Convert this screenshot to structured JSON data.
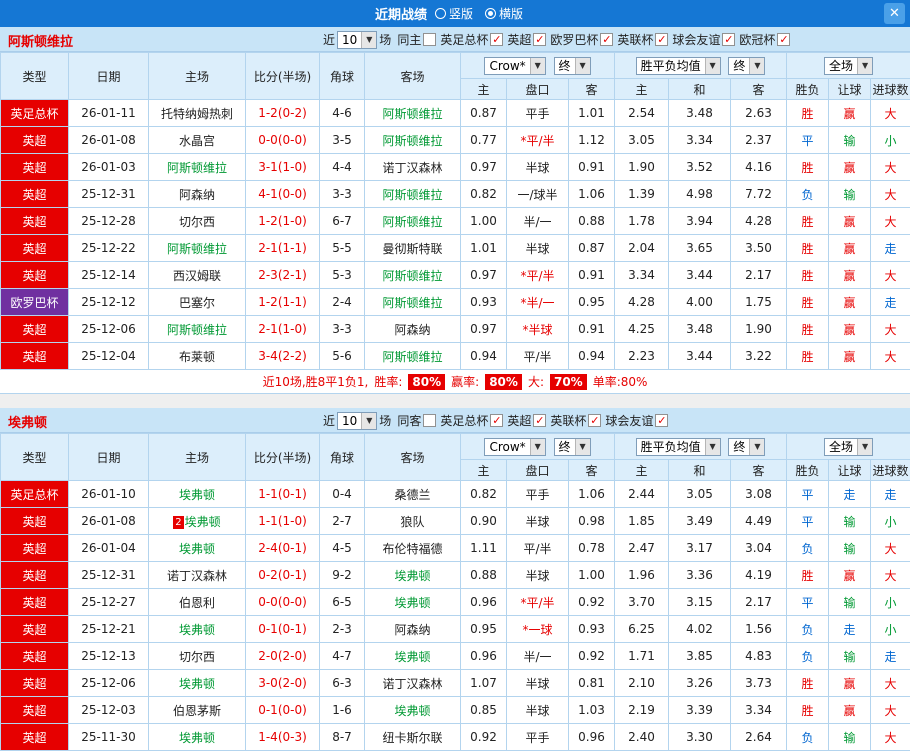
{
  "topbar": {
    "title": "近期战绩",
    "radio_vertical": "竖版",
    "radio_horizontal": "横版",
    "close_icon": "✕"
  },
  "icons": {
    "dropdown_arrow": "▼"
  },
  "controls": {
    "near": "近",
    "count": "10",
    "unit": "场"
  },
  "header_controls": {
    "company": "Crow*",
    "final": "终",
    "avg": "胜平负均值",
    "final2": "终",
    "scope": "全场"
  },
  "table_header": {
    "type": "类型",
    "date": "日期",
    "home": "主场",
    "score": "比分(半场)",
    "corner": "角球",
    "away": "客场",
    "odds_home": "主",
    "odds_line": "盘口",
    "odds_away": "客",
    "avg_home": "主",
    "avg_draw": "和",
    "avg_away": "客",
    "result": "胜负",
    "handicap": "让球",
    "goals": "进球数"
  },
  "sections": [
    {
      "team": "阿斯顿维拉",
      "filters": [
        {
          "label": "同主",
          "mark": ""
        },
        {
          "label": "英足总杯",
          "mark": "✓"
        },
        {
          "label": "英超",
          "mark": "✓"
        },
        {
          "label": "欧罗巴杯",
          "mark": "✓"
        },
        {
          "label": "英联杯",
          "mark": "✓"
        },
        {
          "label": "球会友谊",
          "mark": "✓"
        },
        {
          "label": "欧冠杯",
          "mark": "✓"
        }
      ],
      "rows": [
        {
          "type": "英足总杯",
          "type_cls": "bg-red",
          "date": "26-01-11",
          "home": "托特纳姆热刺",
          "home_cls": "",
          "score": "1-2(0-2)",
          "corner": "4-6",
          "away": "阿斯顿维拉",
          "away_cls": "c-green",
          "o1": "0.87",
          "line": "平手",
          "line_cls": "",
          "o2": "1.01",
          "a1": "2.54",
          "a2": "3.48",
          "a3": "2.63",
          "res": "胜",
          "res_cls": "c-red",
          "han": "赢",
          "han_cls": "c-red",
          "goal": "大",
          "goal_cls": "c-red"
        },
        {
          "type": "英超",
          "type_cls": "bg-red",
          "date": "26-01-08",
          "home": "水晶宫",
          "home_cls": "",
          "score": "0-0(0-0)",
          "corner": "3-5",
          "away": "阿斯顿维拉",
          "away_cls": "c-green",
          "o1": "0.77",
          "line": "*平/半",
          "line_cls": "c-red",
          "o2": "1.12",
          "a1": "3.05",
          "a2": "3.34",
          "a3": "2.37",
          "res": "平",
          "res_cls": "c-blue",
          "han": "输",
          "han_cls": "c-green",
          "goal": "小",
          "goal_cls": "c-green"
        },
        {
          "type": "英超",
          "type_cls": "bg-red",
          "date": "26-01-03",
          "home": "阿斯顿维拉",
          "home_cls": "c-green",
          "score": "3-1(1-0)",
          "corner": "4-4",
          "away": "诺丁汉森林",
          "away_cls": "",
          "o1": "0.97",
          "line": "半球",
          "line_cls": "",
          "o2": "0.91",
          "a1": "1.90",
          "a2": "3.52",
          "a3": "4.16",
          "res": "胜",
          "res_cls": "c-red",
          "han": "赢",
          "han_cls": "c-red",
          "goal": "大",
          "goal_cls": "c-red"
        },
        {
          "type": "英超",
          "type_cls": "bg-red",
          "date": "25-12-31",
          "home": "阿森纳",
          "home_cls": "",
          "score": "4-1(0-0)",
          "corner": "3-3",
          "away": "阿斯顿维拉",
          "away_cls": "c-green",
          "o1": "0.82",
          "line": "一/球半",
          "line_cls": "",
          "o2": "1.06",
          "a1": "1.39",
          "a2": "4.98",
          "a3": "7.72",
          "res": "负",
          "res_cls": "c-blue",
          "han": "输",
          "han_cls": "c-green",
          "goal": "大",
          "goal_cls": "c-red"
        },
        {
          "type": "英超",
          "type_cls": "bg-red",
          "date": "25-12-28",
          "home": "切尔西",
          "home_cls": "",
          "score": "1-2(1-0)",
          "corner": "6-7",
          "away": "阿斯顿维拉",
          "away_cls": "c-green",
          "o1": "1.00",
          "line": "半/一",
          "line_cls": "",
          "o2": "0.88",
          "a1": "1.78",
          "a2": "3.94",
          "a3": "4.28",
          "res": "胜",
          "res_cls": "c-red",
          "han": "赢",
          "han_cls": "c-red",
          "goal": "大",
          "goal_cls": "c-red"
        },
        {
          "type": "英超",
          "type_cls": "bg-red",
          "date": "25-12-22",
          "home": "阿斯顿维拉",
          "home_cls": "c-green",
          "score": "2-1(1-1)",
          "corner": "5-5",
          "away": "曼彻斯特联",
          "away_cls": "",
          "o1": "1.01",
          "line": "半球",
          "line_cls": "",
          "o2": "0.87",
          "a1": "2.04",
          "a2": "3.65",
          "a3": "3.50",
          "res": "胜",
          "res_cls": "c-red",
          "han": "赢",
          "han_cls": "c-red",
          "goal": "走",
          "goal_cls": "c-blue"
        },
        {
          "type": "英超",
          "type_cls": "bg-red",
          "date": "25-12-14",
          "home": "西汉姆联",
          "home_cls": "",
          "score": "2-3(2-1)",
          "corner": "5-3",
          "away": "阿斯顿维拉",
          "away_cls": "c-green",
          "o1": "0.97",
          "line": "*平/半",
          "line_cls": "c-red",
          "o2": "0.91",
          "a1": "3.34",
          "a2": "3.44",
          "a3": "2.17",
          "res": "胜",
          "res_cls": "c-red",
          "han": "赢",
          "han_cls": "c-red",
          "goal": "大",
          "goal_cls": "c-red"
        },
        {
          "type": "欧罗巴杯",
          "type_cls": "bg-purple",
          "date": "25-12-12",
          "home": "巴塞尔",
          "home_cls": "",
          "score": "1-2(1-1)",
          "corner": "2-4",
          "away": "阿斯顿维拉",
          "away_cls": "c-green",
          "o1": "0.93",
          "line": "*半/一",
          "line_cls": "c-red",
          "o2": "0.95",
          "a1": "4.28",
          "a2": "4.00",
          "a3": "1.75",
          "res": "胜",
          "res_cls": "c-red",
          "han": "赢",
          "han_cls": "c-red",
          "goal": "走",
          "goal_cls": "c-blue"
        },
        {
          "type": "英超",
          "type_cls": "bg-red",
          "date": "25-12-06",
          "home": "阿斯顿维拉",
          "home_cls": "c-green",
          "score": "2-1(1-0)",
          "corner": "3-3",
          "away": "阿森纳",
          "away_cls": "",
          "o1": "0.97",
          "line": "*半球",
          "line_cls": "c-red",
          "o2": "0.91",
          "a1": "4.25",
          "a2": "3.48",
          "a3": "1.90",
          "res": "胜",
          "res_cls": "c-red",
          "han": "赢",
          "han_cls": "c-red",
          "goal": "大",
          "goal_cls": "c-red"
        },
        {
          "type": "英超",
          "type_cls": "bg-red",
          "date": "25-12-04",
          "home": "布莱顿",
          "home_cls": "",
          "score": "3-4(2-2)",
          "corner": "5-6",
          "away": "阿斯顿维拉",
          "away_cls": "c-green",
          "o1": "0.94",
          "line": "平/半",
          "line_cls": "",
          "o2": "0.94",
          "a1": "2.23",
          "a2": "3.44",
          "a3": "3.22",
          "res": "胜",
          "res_cls": "c-red",
          "han": "赢",
          "han_cls": "c-red",
          "goal": "大",
          "goal_cls": "c-red"
        }
      ],
      "summary": {
        "text": "近10场,胜8平1负1,",
        "win_label": "胜率:",
        "win_pct": "80%",
        "profit_label": "赢率:",
        "profit_pct": "80%",
        "big_label": "大:",
        "big_pct": "70%",
        "single": "单率:80%"
      }
    },
    {
      "team": "埃弗顿",
      "filters": [
        {
          "label": "同客",
          "mark": ""
        },
        {
          "label": "英足总杯",
          "mark": "✓"
        },
        {
          "label": "英超",
          "mark": "✓"
        },
        {
          "label": "英联杯",
          "mark": "✓"
        },
        {
          "label": "球会友谊",
          "mark": "✓"
        }
      ],
      "rows": [
        {
          "type": "英足总杯",
          "type_cls": "bg-red",
          "date": "26-01-10",
          "home": "埃弗顿",
          "home_cls": "c-green",
          "score": "1-1(0-1)",
          "corner": "0-4",
          "away": "桑德兰",
          "away_cls": "",
          "o1": "0.82",
          "line": "平手",
          "line_cls": "",
          "o2": "1.06",
          "a1": "2.44",
          "a2": "3.05",
          "a3": "3.08",
          "res": "平",
          "res_cls": "c-blue",
          "han": "走",
          "han_cls": "c-blue",
          "goal": "走",
          "goal_cls": "c-blue"
        },
        {
          "type": "英超",
          "type_cls": "bg-red",
          "date": "26-01-08",
          "home": "埃弗顿",
          "home_cls": "c-green",
          "home_badge": "2",
          "score": "1-1(1-0)",
          "corner": "2-7",
          "away": "狼队",
          "away_cls": "",
          "o1": "0.90",
          "line": "半球",
          "line_cls": "",
          "o2": "0.98",
          "a1": "1.85",
          "a2": "3.49",
          "a3": "4.49",
          "res": "平",
          "res_cls": "c-blue",
          "han": "输",
          "han_cls": "c-green",
          "goal": "小",
          "goal_cls": "c-green"
        },
        {
          "type": "英超",
          "type_cls": "bg-red",
          "date": "26-01-04",
          "home": "埃弗顿",
          "home_cls": "c-green",
          "score": "2-4(0-1)",
          "corner": "4-5",
          "away": "布伦特福德",
          "away_cls": "",
          "o1": "1.11",
          "line": "平/半",
          "line_cls": "",
          "o2": "0.78",
          "a1": "2.47",
          "a2": "3.17",
          "a3": "3.04",
          "res": "负",
          "res_cls": "c-blue",
          "han": "输",
          "han_cls": "c-green",
          "goal": "大",
          "goal_cls": "c-red"
        },
        {
          "type": "英超",
          "type_cls": "bg-red",
          "date": "25-12-31",
          "home": "诺丁汉森林",
          "home_cls": "",
          "score": "0-2(0-1)",
          "corner": "9-2",
          "away": "埃弗顿",
          "away_cls": "c-green",
          "o1": "0.88",
          "line": "半球",
          "line_cls": "",
          "o2": "1.00",
          "a1": "1.96",
          "a2": "3.36",
          "a3": "4.19",
          "res": "胜",
          "res_cls": "c-red",
          "han": "赢",
          "han_cls": "c-red",
          "goal": "大",
          "goal_cls": "c-red"
        },
        {
          "type": "英超",
          "type_cls": "bg-red",
          "date": "25-12-27",
          "home": "伯恩利",
          "home_cls": "",
          "score": "0-0(0-0)",
          "corner": "6-5",
          "away": "埃弗顿",
          "away_cls": "c-green",
          "o1": "0.96",
          "line": "*平/半",
          "line_cls": "c-red",
          "o2": "0.92",
          "a1": "3.70",
          "a2": "3.15",
          "a3": "2.17",
          "res": "平",
          "res_cls": "c-blue",
          "han": "输",
          "han_cls": "c-green",
          "goal": "小",
          "goal_cls": "c-green"
        },
        {
          "type": "英超",
          "type_cls": "bg-red",
          "date": "25-12-21",
          "home": "埃弗顿",
          "home_cls": "c-green",
          "score": "0-1(0-1)",
          "corner": "2-3",
          "away": "阿森纳",
          "away_cls": "",
          "o1": "0.95",
          "line": "*一球",
          "line_cls": "c-red",
          "o2": "0.93",
          "a1": "6.25",
          "a2": "4.02",
          "a3": "1.56",
          "res": "负",
          "res_cls": "c-blue",
          "han": "走",
          "han_cls": "c-blue",
          "goal": "小",
          "goal_cls": "c-green"
        },
        {
          "type": "英超",
          "type_cls": "bg-red",
          "date": "25-12-13",
          "home": "切尔西",
          "home_cls": "",
          "score": "2-0(2-0)",
          "corner": "4-7",
          "away": "埃弗顿",
          "away_cls": "c-green",
          "o1": "0.96",
          "line": "半/一",
          "line_cls": "",
          "o2": "0.92",
          "a1": "1.71",
          "a2": "3.85",
          "a3": "4.83",
          "res": "负",
          "res_cls": "c-blue",
          "han": "输",
          "han_cls": "c-green",
          "goal": "走",
          "goal_cls": "c-blue"
        },
        {
          "type": "英超",
          "type_cls": "bg-red",
          "date": "25-12-06",
          "home": "埃弗顿",
          "home_cls": "c-green",
          "score": "3-0(2-0)",
          "corner": "6-3",
          "away": "诺丁汉森林",
          "away_cls": "",
          "o1": "1.07",
          "line": "半球",
          "line_cls": "",
          "o2": "0.81",
          "a1": "2.10",
          "a2": "3.26",
          "a3": "3.73",
          "res": "胜",
          "res_cls": "c-red",
          "han": "赢",
          "han_cls": "c-red",
          "goal": "大",
          "goal_cls": "c-red"
        },
        {
          "type": "英超",
          "type_cls": "bg-red",
          "date": "25-12-03",
          "home": "伯恩茅斯",
          "home_cls": "",
          "score": "0-1(0-0)",
          "corner": "1-6",
          "away": "埃弗顿",
          "away_cls": "c-green",
          "o1": "0.85",
          "line": "半球",
          "line_cls": "",
          "o2": "1.03",
          "a1": "2.19",
          "a2": "3.39",
          "a3": "3.34",
          "res": "胜",
          "res_cls": "c-red",
          "han": "赢",
          "han_cls": "c-red",
          "goal": "大",
          "goal_cls": "c-red"
        },
        {
          "type": "英超",
          "type_cls": "bg-red",
          "date": "25-11-30",
          "home": "埃弗顿",
          "home_cls": "c-green",
          "score": "1-4(0-3)",
          "corner": "8-7",
          "away": "纽卡斯尔联",
          "away_cls": "",
          "o1": "0.92",
          "line": "平手",
          "line_cls": "",
          "o2": "0.96",
          "a1": "2.40",
          "a2": "3.30",
          "a3": "2.64",
          "res": "负",
          "res_cls": "c-blue",
          "han": "输",
          "han_cls": "c-green",
          "goal": "大",
          "goal_cls": "c-red"
        }
      ]
    }
  ]
}
